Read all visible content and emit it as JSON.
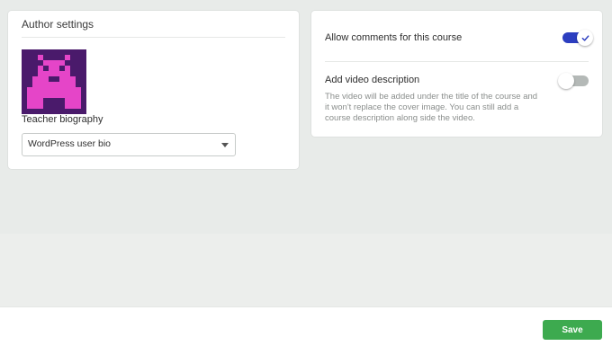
{
  "author_settings": {
    "title": "Author settings",
    "avatar_icon": "pixel-monster-avatar",
    "avatar_colors": {
      "background": "#4a1a6b",
      "figure": "#e545c8"
    },
    "bio_label": "Teacher biography",
    "bio_select": {
      "value": "WordPress user bio"
    }
  },
  "course_settings": {
    "allow_comments": {
      "label": "Allow comments for this course",
      "enabled": true
    },
    "video_description": {
      "label": "Add video description",
      "enabled": false,
      "description": "The video will be added under the title of the course and it won't replace the cover image. You can still add a course description along side the video."
    },
    "toggle_on_color": "#2c3ec0",
    "toggle_off_color": "#b4b9b7"
  },
  "footer": {
    "save_label": "Save",
    "save_color": "#3daa4f"
  }
}
